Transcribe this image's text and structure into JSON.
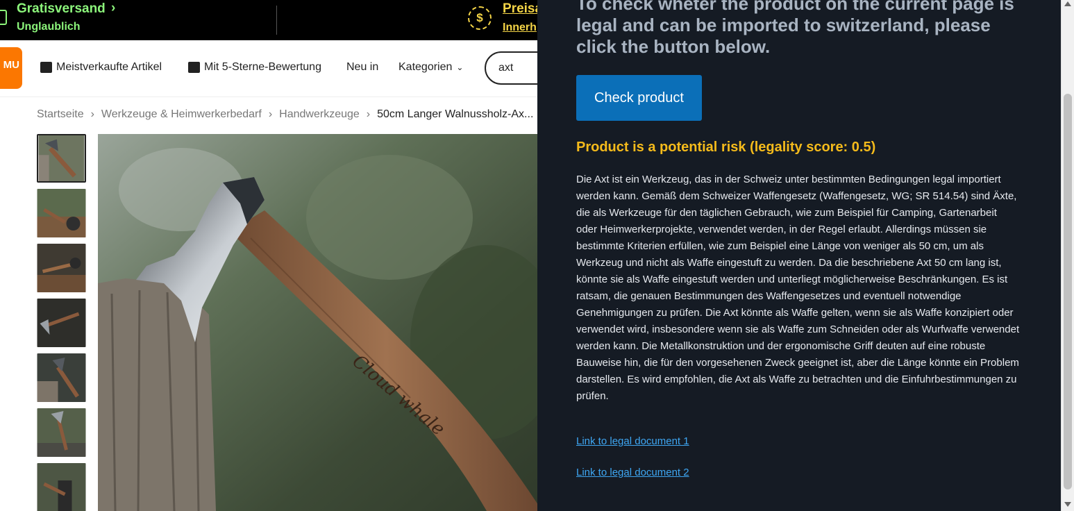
{
  "promo": {
    "shipping_title": "Gratisversand",
    "shipping_sub": "Unglaublich",
    "price_title": "Preisa",
    "price_sub": "Innerh"
  },
  "nav": {
    "bestsellers": "Meistverkaufte Artikel",
    "five_star": "Mit 5-Sterne-Bewertung",
    "new_in": "Neu in",
    "categories": "Kategorien",
    "search_value": "axt",
    "logo_text": "MU"
  },
  "breadcrumb": {
    "items": [
      "Startseite",
      "Werkzeuge & Heimwerkerbedarf",
      "Handwerkzeuge",
      "50cm Langer Walnussholz-Ax..."
    ],
    "separator": "›"
  },
  "product": {
    "engraving": "Cloud whale"
  },
  "panel": {
    "heading": "To check wheter the product on the current page is legal and can be imported to switzerland, please click the button below.",
    "check_button": "Check product",
    "risk_title": "Product is a potential risk (legality score: 0.5)",
    "risk_color": "#f5bb1b",
    "risk_body": "Die Axt ist ein Werkzeug, das in der Schweiz unter bestimmten Bedingungen legal importiert werden kann. Gemäß dem Schweizer Waffengesetz (Waffengesetz, WG; SR 514.54) sind Äxte, die als Werkzeuge für den täglichen Gebrauch, wie zum Beispiel für Camping, Gartenarbeit oder Heimwerkerprojekte, verwendet werden, in der Regel erlaubt. Allerdings müssen sie bestimmte Kriterien erfüllen, wie zum Beispiel eine Länge von weniger als 50 cm, um als Werkzeug und nicht als Waffe eingestuft zu werden. Da die beschriebene Axt 50 cm lang ist, könnte sie als Waffe eingestuft werden und unterliegt möglicherweise Beschränkungen. Es ist ratsam, die genauen Bestimmungen des Waffengesetzes und eventuell notwendige Genehmigungen zu prüfen. Die Axt könnte als Waffe gelten, wenn sie als Waffe konzipiert oder verwendet wird, insbesondere wenn sie als Waffe zum Schneiden oder als Wurfwaffe verwendet werden kann. Die Metallkonstruktion und der ergonomische Griff deuten auf eine robuste Bauweise hin, die für den vorgesehenen Zweck geeignet ist, aber die Länge könnte ein Problem darstellen. Es wird empfohlen, die Axt als Waffe zu betrachten und die Einfuhrbestimmungen zu prüfen.",
    "link1": "Link to legal document 1",
    "link2": "Link to legal document 2"
  }
}
